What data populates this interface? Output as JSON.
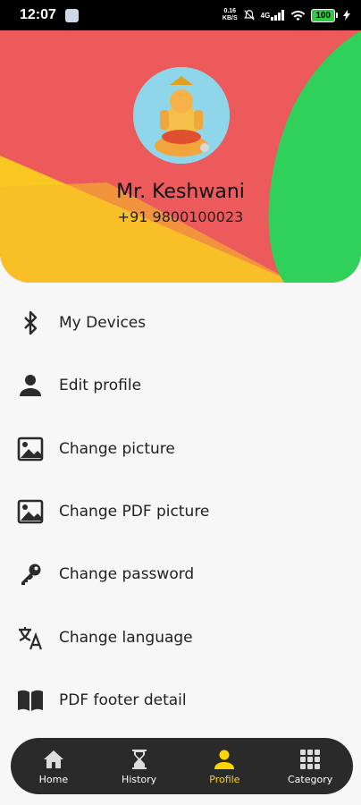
{
  "status_bar": {
    "time": "12:07",
    "net_speed_value": "0.16",
    "net_speed_unit": "KB/S",
    "network": "4G",
    "battery": "100"
  },
  "profile": {
    "name": "Mr. Keshwani",
    "phone": "+91 9800100023"
  },
  "menu": {
    "items": [
      {
        "label": "My Devices",
        "icon": "bluetooth-icon"
      },
      {
        "label": "Edit profile",
        "icon": "person-icon"
      },
      {
        "label": "Change picture",
        "icon": "image-icon"
      },
      {
        "label": "Change PDF picture",
        "icon": "image-icon"
      },
      {
        "label": "Change password",
        "icon": "key-icon"
      },
      {
        "label": "Change language",
        "icon": "translate-icon"
      },
      {
        "label": "PDF footer detail",
        "icon": "book-icon"
      }
    ]
  },
  "bottom_nav": {
    "items": [
      {
        "label": "Home",
        "icon": "home-icon"
      },
      {
        "label": "History",
        "icon": "hourglass-icon"
      },
      {
        "label": "Profile",
        "icon": "person-icon"
      },
      {
        "label": "Category",
        "icon": "grid-icon"
      }
    ],
    "active": "Profile",
    "active_color": "#ffd400"
  },
  "colors": {
    "header_red": "#ec5a5b",
    "header_yellow": "#f9c823",
    "header_green": "#2fd15a",
    "nav_background": "#2a2a2a"
  }
}
